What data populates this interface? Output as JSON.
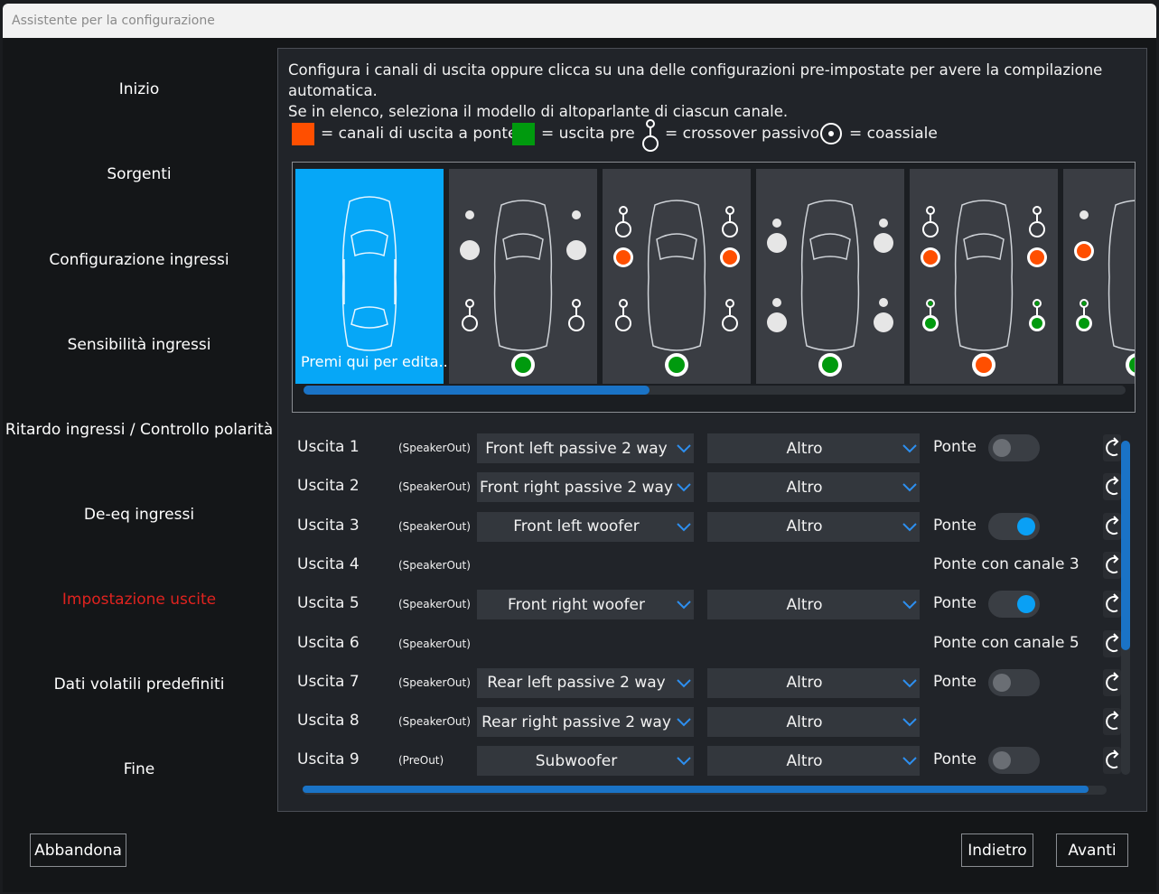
{
  "window": {
    "title": "Assistente per la configurazione"
  },
  "steps": [
    {
      "label": "Inizio",
      "active": false
    },
    {
      "label": "Sorgenti",
      "active": false
    },
    {
      "label": "Configurazione ingressi",
      "active": false
    },
    {
      "label": "Sensibilità ingressi",
      "active": false
    },
    {
      "label": "Ritardo ingressi / Controllo polarità",
      "active": false
    },
    {
      "label": "De-eq ingressi",
      "active": false
    },
    {
      "label": "Impostazione uscite",
      "active": true
    },
    {
      "label": "Dati volatili predefiniti",
      "active": false
    },
    {
      "label": "Fine",
      "active": false
    }
  ],
  "intro": {
    "line1": "Configura i canali di uscita oppure clicca su una delle configurazioni pre-impostate per avere la compilazione automatica.",
    "line2": "Se in elenco, seleziona il modello di altoparlante di ciascun canale."
  },
  "legend": {
    "bridge_label": "= canali di uscita a ponte",
    "pre_label": "= uscita pre",
    "crossover_label": "= crossover passivo",
    "coaxial_label": "= coassiale",
    "bridge_color": "#ff4f00",
    "pre_color": "#009a0e"
  },
  "presets": {
    "edit_label": "Premi qui per edita...",
    "selected_color": "#06a7f7",
    "scroll_fraction": 0.42
  },
  "outputs": [
    {
      "name": "Uscita 1",
      "type": "(SpeakerOut)",
      "speaker": "Front left passive 2 way",
      "model": "Altro",
      "bridge": "Ponte",
      "toggle": "off"
    },
    {
      "name": "Uscita 2",
      "type": "(SpeakerOut)",
      "speaker": "Front right passive 2 way",
      "model": "Altro",
      "bridge": "",
      "toggle": "none"
    },
    {
      "name": "Uscita 3",
      "type": "(SpeakerOut)",
      "speaker": "Front left woofer",
      "model": "Altro",
      "bridge": "Ponte",
      "toggle": "on"
    },
    {
      "name": "Uscita 4",
      "type": "(SpeakerOut)",
      "speaker": "",
      "model": "",
      "bridge": "Ponte con canale 3",
      "toggle": "none"
    },
    {
      "name": "Uscita 5",
      "type": "(SpeakerOut)",
      "speaker": "Front right woofer",
      "model": "Altro",
      "bridge": "Ponte",
      "toggle": "on"
    },
    {
      "name": "Uscita 6",
      "type": "(SpeakerOut)",
      "speaker": "",
      "model": "",
      "bridge": "Ponte con canale 5",
      "toggle": "none"
    },
    {
      "name": "Uscita 7",
      "type": "(SpeakerOut)",
      "speaker": "Rear left passive 2 way",
      "model": "Altro",
      "bridge": "Ponte",
      "toggle": "off"
    },
    {
      "name": "Uscita 8",
      "type": "(SpeakerOut)",
      "speaker": "Rear right passive 2 way",
      "model": "Altro",
      "bridge": "",
      "toggle": "none"
    },
    {
      "name": "Uscita 9",
      "type": "(PreOut)",
      "speaker": "Subwoofer",
      "model": "Altro",
      "bridge": "Ponte",
      "toggle": "off"
    }
  ],
  "buttons": {
    "abort": "Abbandona",
    "back": "Indietro",
    "next": "Avanti"
  }
}
